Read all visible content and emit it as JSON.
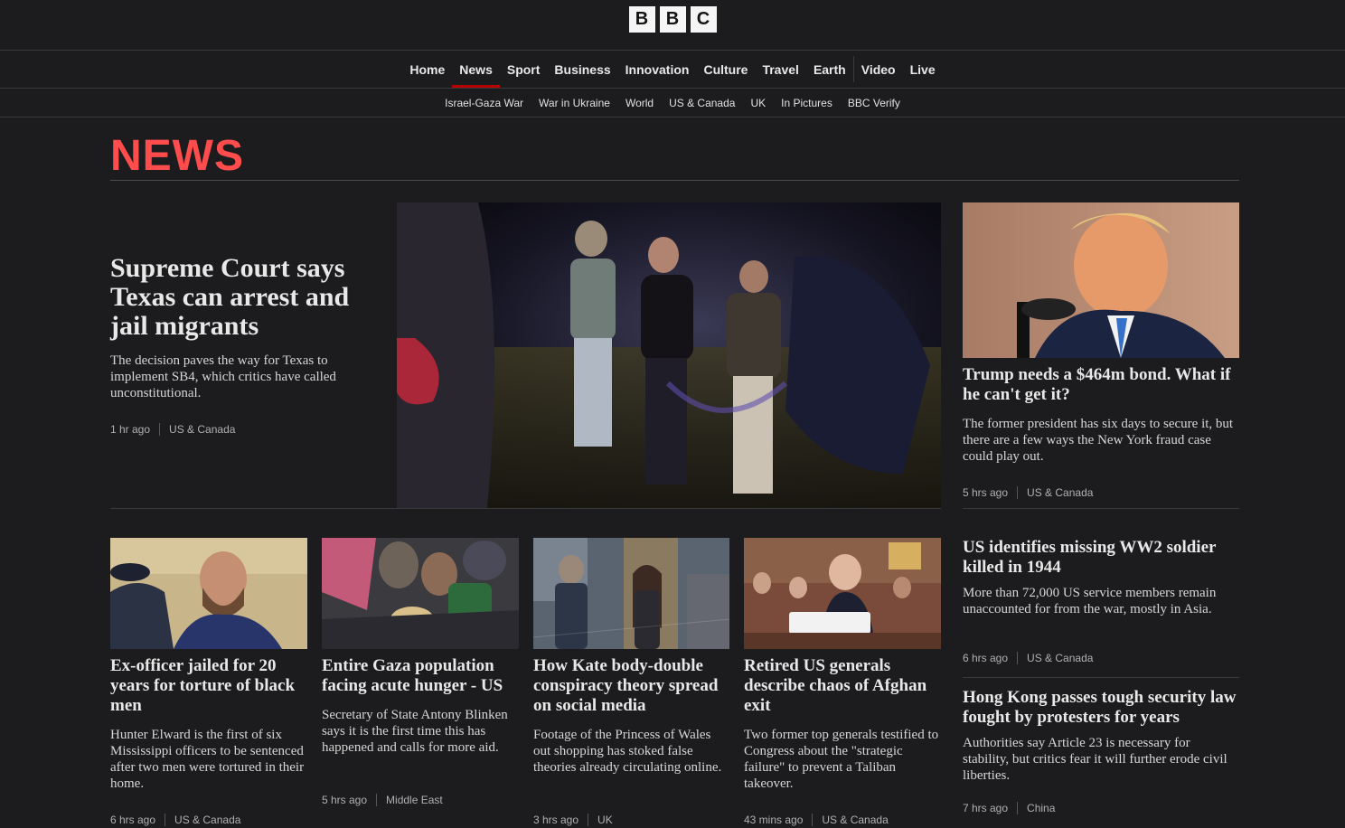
{
  "brand": {
    "letters": [
      "B",
      "B",
      "C"
    ]
  },
  "main_nav": [
    "Home",
    "News",
    "Sport",
    "Business",
    "Innovation",
    "Culture",
    "Travel",
    "Earth",
    "Video",
    "Live"
  ],
  "main_nav_active": "News",
  "sub_nav": [
    "Israel-Gaza War",
    "War in Ukraine",
    "World",
    "US & Canada",
    "UK",
    "In Pictures",
    "BBC Verify"
  ],
  "section_title": "NEWS",
  "lead": {
    "title": "Supreme Court says Texas can arrest and jail migrants",
    "summary": "The decision paves the way for Texas to implement SB4, which critics have called unconstitutional.",
    "time": "1 hr ago",
    "tag": "US & Canada"
  },
  "right_feature": {
    "title": "Trump needs a $464m bond. What if he can't get it?",
    "summary": "The former president has six days to secure it, but there are a few ways the New York fraud case could play out.",
    "time": "5 hrs ago",
    "tag": "US & Canada"
  },
  "cards": [
    {
      "title": "Ex-officer jailed for 20 years for torture of black men",
      "summary": "Hunter Elward is the first of six Mississippi officers to be sentenced after two men were tortured in their home.",
      "time": "6 hrs ago",
      "tag": "US & Canada"
    },
    {
      "title": "Entire Gaza population facing acute hunger - US",
      "summary": "Secretary of State Antony Blinken says it is the first time this has happened and calls for more aid.",
      "time": "5 hrs ago",
      "tag": "Middle East"
    },
    {
      "title": "How Kate body-double conspiracy theory spread on social media",
      "summary": "Footage of the Princess of Wales out shopping has stoked false theories already circulating online.",
      "time": "3 hrs ago",
      "tag": "UK"
    },
    {
      "title": "Retired US generals describe chaos of Afghan exit",
      "summary": "Two former top generals testified to Congress about the \"strategic failure\" to prevent a Taliban takeover.",
      "time": "43 mins ago",
      "tag": "US & Canada"
    }
  ],
  "side_stories": [
    {
      "title": "US identifies missing WW2 soldier killed in 1944",
      "summary": "More than 72,000 US service members remain unaccounted for from the war, mostly in Asia.",
      "time": "6 hrs ago",
      "tag": "US & Canada"
    },
    {
      "title": "Hong Kong passes tough security law fought by protesters for years",
      "summary": "Authorities say Article 23 is necessary for stability, but critics fear it will further erode civil liberties.",
      "time": "7 hrs ago",
      "tag": "China"
    }
  ]
}
